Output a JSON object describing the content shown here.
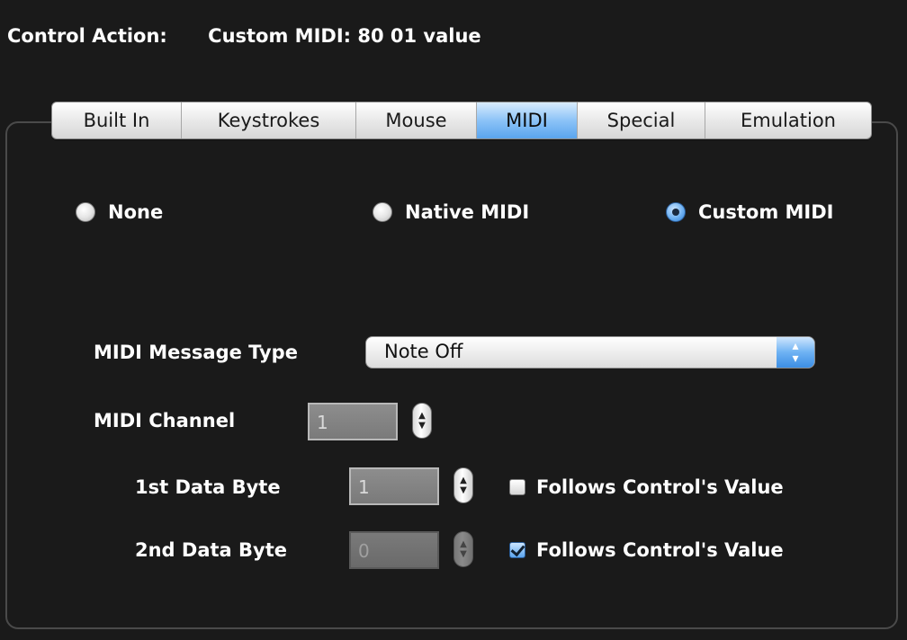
{
  "header": {
    "label": "Control Action:",
    "value": "Custom MIDI: 80 01  value"
  },
  "tabs": [
    {
      "label": "Built In",
      "active": false
    },
    {
      "label": "Keystrokes",
      "active": false
    },
    {
      "label": "Mouse",
      "active": false
    },
    {
      "label": "MIDI",
      "active": true
    },
    {
      "label": "Special",
      "active": false
    },
    {
      "label": "Emulation",
      "active": false
    }
  ],
  "midi_mode": {
    "options": [
      {
        "label": "None",
        "selected": false
      },
      {
        "label": "Native MIDI",
        "selected": false
      },
      {
        "label": "Custom MIDI",
        "selected": true
      }
    ]
  },
  "message_type": {
    "label": "MIDI Message Type",
    "selected": "Note Off"
  },
  "channel": {
    "label": "MIDI Channel",
    "value": "1"
  },
  "data_byte_1": {
    "label": "1st Data Byte",
    "value": "1",
    "follows_label": "Follows Control's Value",
    "follows_checked": false
  },
  "data_byte_2": {
    "label": "2nd Data Byte",
    "value": "0",
    "follows_label": "Follows Control's Value",
    "follows_checked": true
  },
  "colors": {
    "background": "#1a1a1a",
    "accent": "#5aa5ee"
  }
}
